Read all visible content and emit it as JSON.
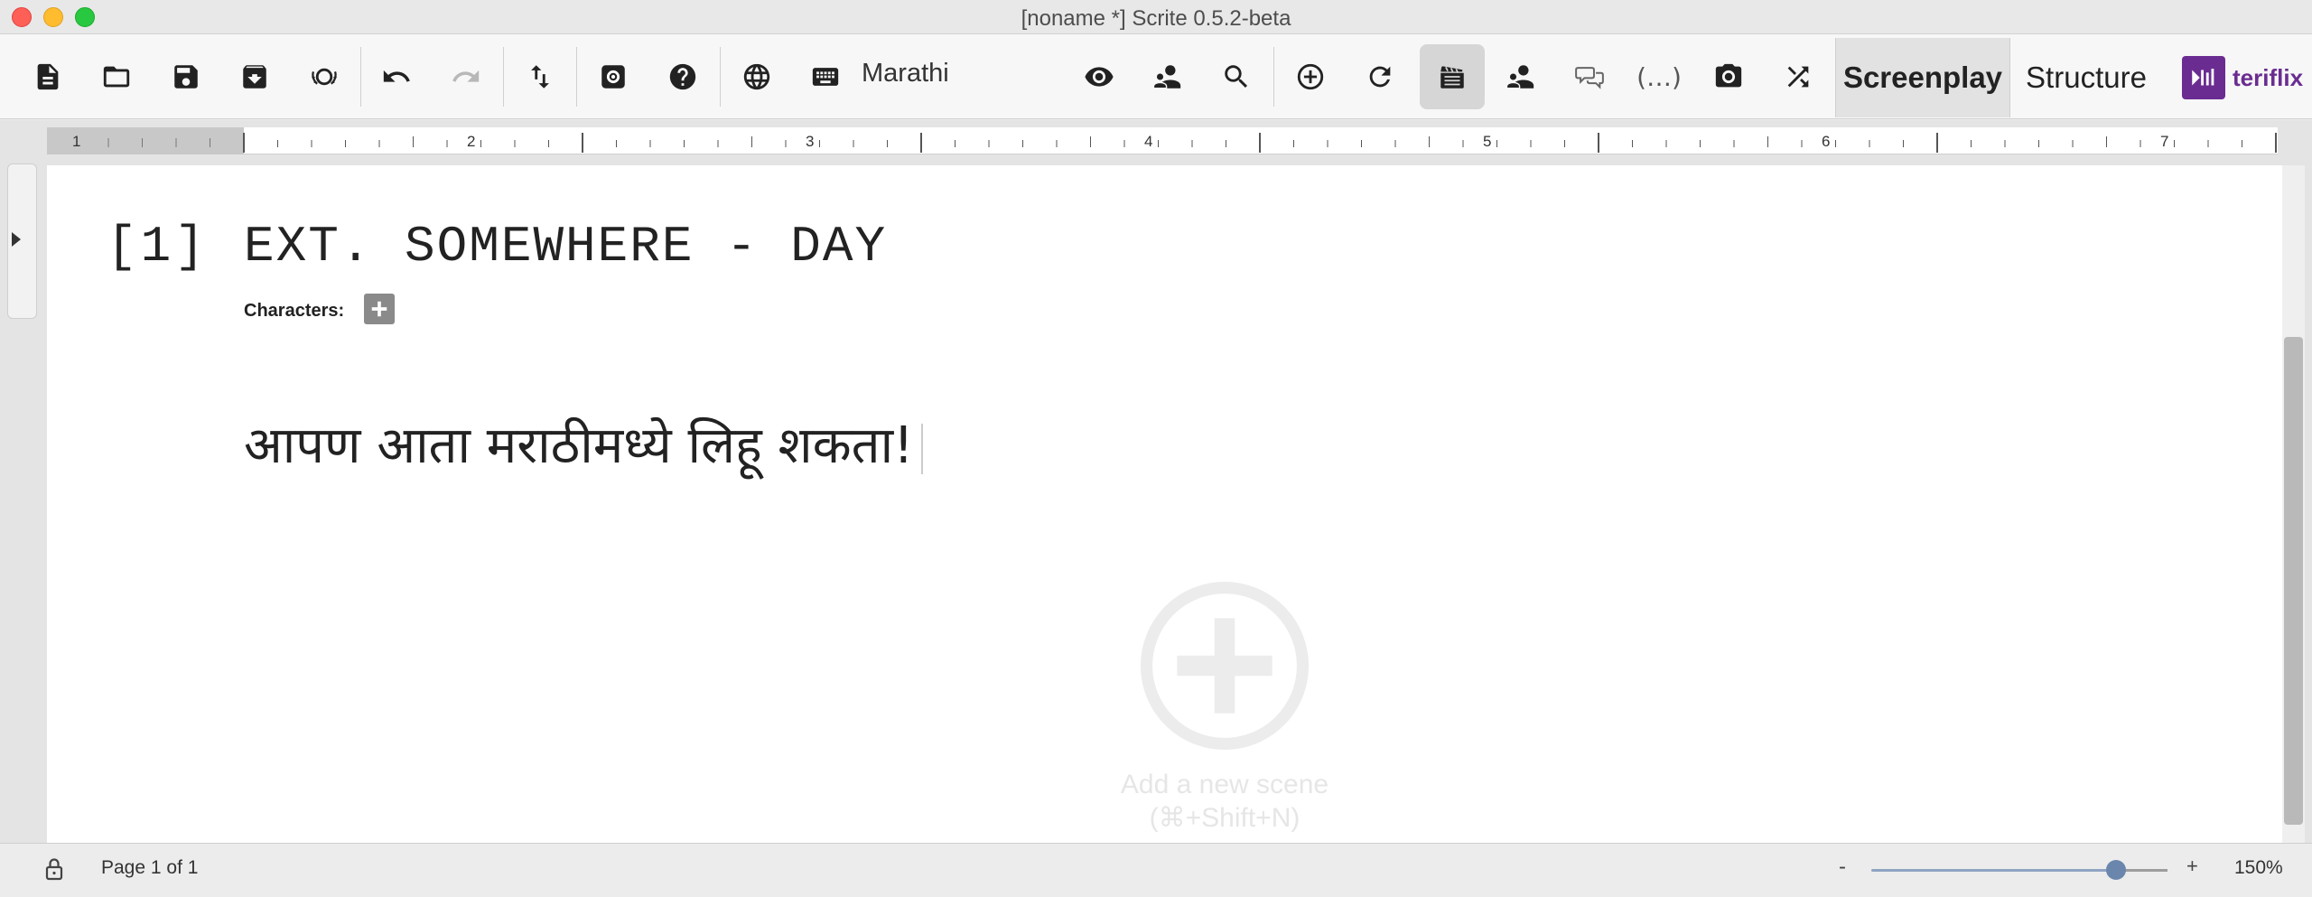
{
  "window": {
    "title": "[noname *] Scrite 0.5.2-beta"
  },
  "toolbar": {
    "language_label": "Marathi",
    "tabs": {
      "screenplay": "Screenplay",
      "structure": "Structure"
    },
    "brand": "teriflix",
    "icons": [
      "new-file-icon",
      "open-folder-icon",
      "save-icon",
      "archive-icon",
      "awards-icon",
      "undo-icon",
      "redo-icon",
      "import-export-icon",
      "settings-icon",
      "help-icon",
      "language-globe-icon",
      "keyboard-icon",
      "eye-icon",
      "characters-icon",
      "search-icon",
      "add-circle-icon",
      "refresh-icon",
      "scene-clapperboard-icon",
      "character-icon",
      "dialogue-icon",
      "parenthetical-icon",
      "camera-icon",
      "shuffle-icon"
    ],
    "parenthetical_label": "(…)"
  },
  "ruler": {
    "numbers": [
      "1",
      "2",
      "3",
      "4",
      "5",
      "6",
      "7"
    ]
  },
  "scene": {
    "number": "[1]",
    "heading": "EXT. SOMEWHERE - DAY",
    "characters_label": "Characters:",
    "action": "आपण आता मराठीमध्ये लिहू शकता!"
  },
  "add_scene": {
    "line1": "Add a new scene",
    "line2": "(⌘+Shift+N)"
  },
  "status": {
    "page_info": "Page 1 of 1",
    "zoom_minus": "-",
    "zoom_plus": "+",
    "zoom_level": "150%",
    "zoom_fraction": 0.8
  },
  "colors": {
    "brand": "#6a2c91",
    "traffic_red": "#fe5f57",
    "traffic_yellow": "#febc2e",
    "traffic_green": "#28c840",
    "zoom_accent": "#6b86ad"
  }
}
